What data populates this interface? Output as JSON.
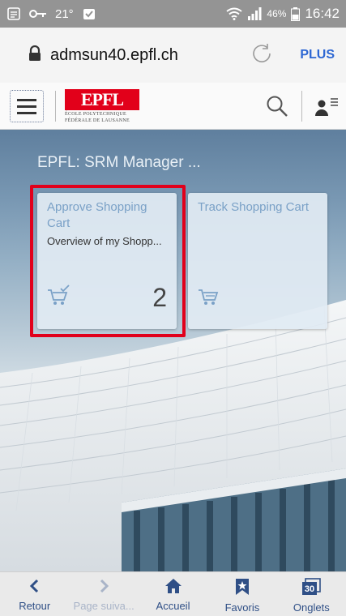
{
  "status_bar": {
    "temperature": "21°",
    "battery": "46%",
    "time": "16:42"
  },
  "browser": {
    "url": "admsun40.epfl.ch",
    "more_label": "PLUS"
  },
  "header": {
    "logo_text": "EPFL",
    "logo_line1": "ÉCOLE POLYTECHNIQUE",
    "logo_line2": "FÉDÉRALE DE LAUSANNE"
  },
  "page": {
    "title": "EPFL: SRM Manager ..."
  },
  "tiles": [
    {
      "title": "Approve Shopping Cart",
      "subtitle": "Overview of my Shopp...",
      "count": "2",
      "icon": "cart-check-icon"
    },
    {
      "title": "Track Shopping Cart",
      "subtitle": "",
      "icon": "cart-icon"
    }
  ],
  "bottom_nav": [
    {
      "label": "Retour",
      "icon": "back-icon",
      "enabled": true
    },
    {
      "label": "Page suiva...",
      "icon": "forward-icon",
      "enabled": false
    },
    {
      "label": "Accueil",
      "icon": "home-icon",
      "enabled": true
    },
    {
      "label": "Favoris",
      "icon": "bookmark-icon",
      "enabled": true
    },
    {
      "label": "Onglets",
      "icon": "tabs-icon",
      "enabled": true,
      "count": "30"
    }
  ],
  "colors": {
    "highlight": "#e1001b",
    "accent": "#2d67d3",
    "tile_title": "#7aa1c7",
    "epfl_red": "#e2001a"
  }
}
